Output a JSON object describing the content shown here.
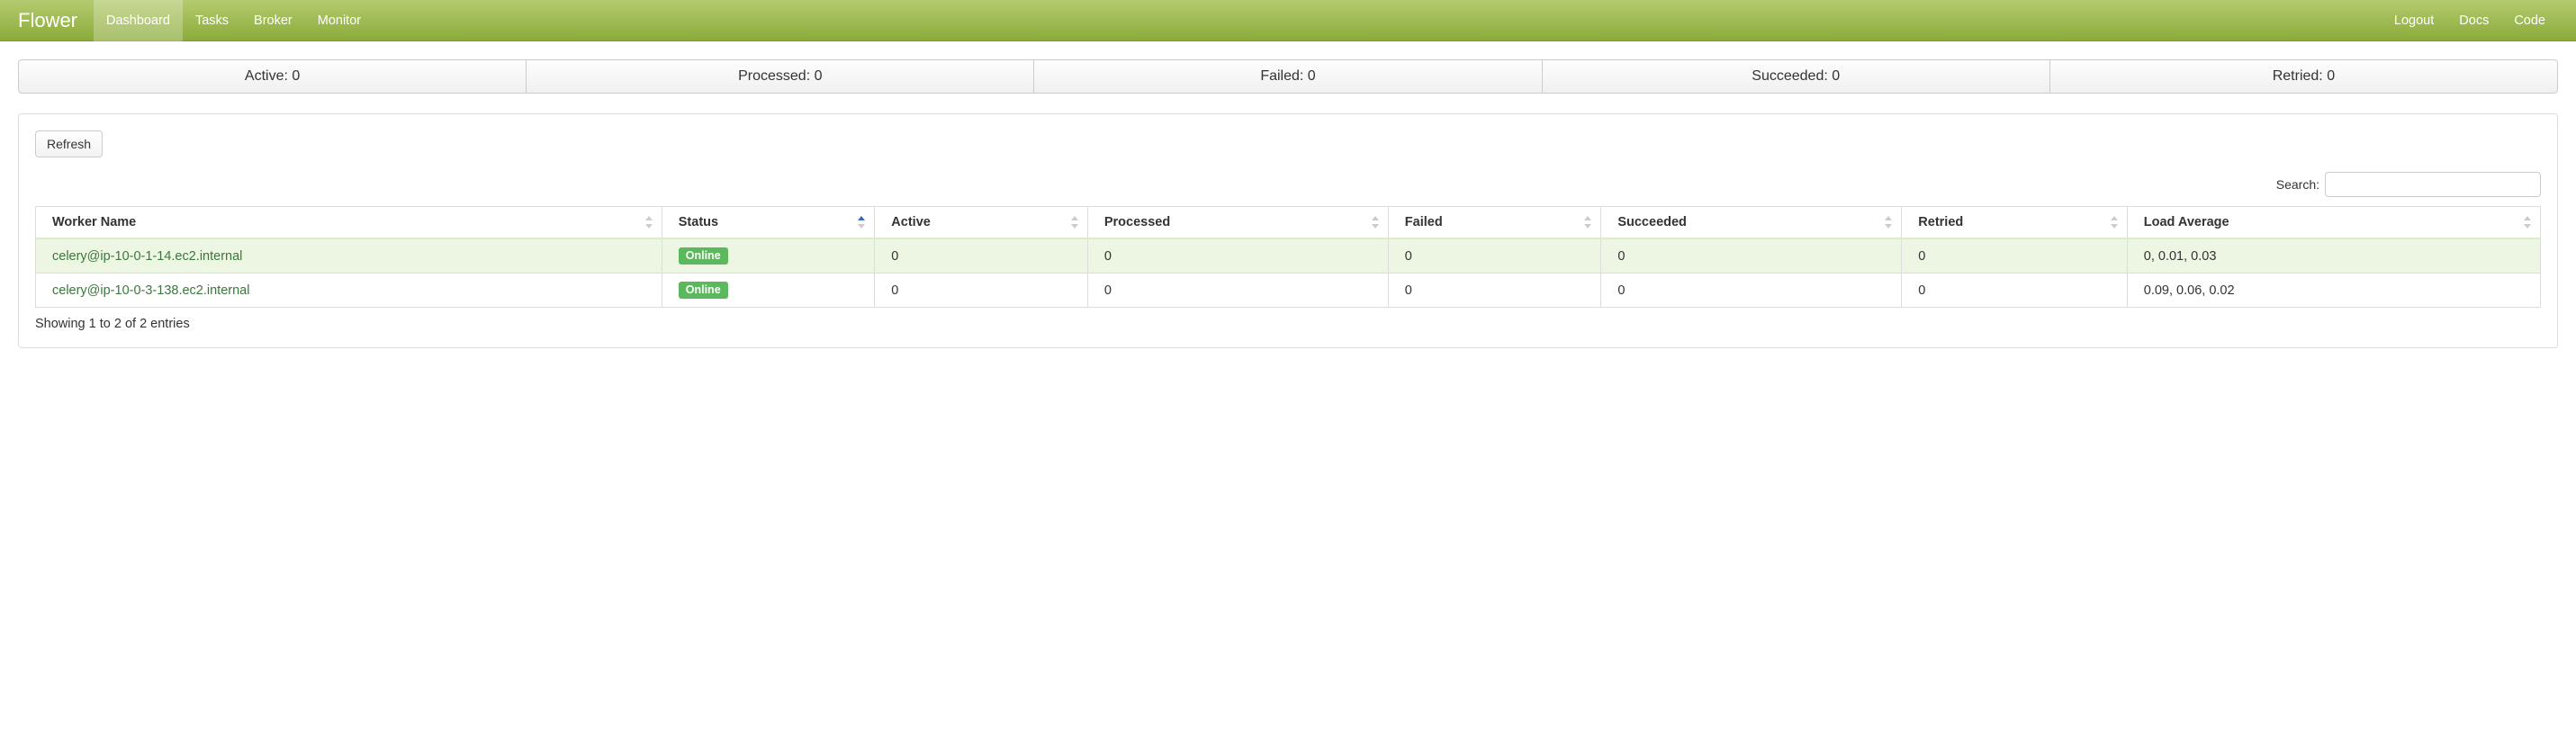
{
  "brand": "Flower",
  "nav": {
    "left": [
      "Dashboard",
      "Tasks",
      "Broker",
      "Monitor"
    ],
    "active_index": 0,
    "right": [
      "Logout",
      "Docs",
      "Code"
    ]
  },
  "stats": {
    "active_label": "Active: 0",
    "processed_label": "Processed: 0",
    "failed_label": "Failed: 0",
    "succeeded_label": "Succeeded: 0",
    "retried_label": "Retried: 0"
  },
  "buttons": {
    "refresh": "Refresh"
  },
  "search": {
    "label": "Search:",
    "value": ""
  },
  "table": {
    "headers": {
      "worker_name": "Worker Name",
      "status": "Status",
      "active": "Active",
      "processed": "Processed",
      "failed": "Failed",
      "succeeded": "Succeeded",
      "retried": "Retried",
      "load_average": "Load Average"
    },
    "sorted_column": "status",
    "sort_dir": "asc",
    "rows": [
      {
        "worker_name": "celery@ip-10-0-1-14.ec2.internal",
        "status": "Online",
        "active": "0",
        "processed": "0",
        "failed": "0",
        "succeeded": "0",
        "retried": "0",
        "load_average": "0, 0.01, 0.03"
      },
      {
        "worker_name": "celery@ip-10-0-3-138.ec2.internal",
        "status": "Online",
        "active": "0",
        "processed": "0",
        "failed": "0",
        "succeeded": "0",
        "retried": "0",
        "load_average": "0.09, 0.06, 0.02"
      }
    ],
    "info": "Showing 1 to 2 of 2 entries"
  }
}
